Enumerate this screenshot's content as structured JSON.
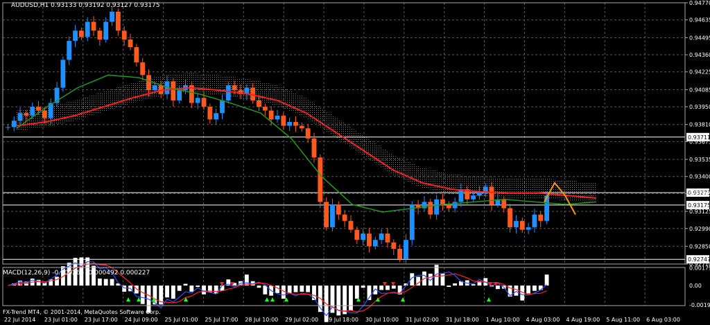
{
  "header": {
    "symbol_line": "AUDUSD,H1  0.93133 0.93192 0.93127 0.93175"
  },
  "macd_header": "MACD(12,26,9) -0.000265 -0.000492 0.000227",
  "copyright": "FX-Trend MT4, © 2001-2014, MetaQuotes Software Corp.",
  "colors": {
    "background": "#000000",
    "grid": "#5a5a5a",
    "candle_up": "#1e90ff",
    "candle_down": "#ff5a1e",
    "ma_red": "#ff2020",
    "ma_green": "#1f9a1f",
    "cloud": "#f5d6c0",
    "forecast": "#ff9900",
    "hline": "#ffffff",
    "macd_hist": "#ffffff",
    "macd_main": "#3050ff",
    "macd_signal": "#ff2020",
    "arrow_up": "#20ff20",
    "arrow_down": "#ff2020"
  },
  "chart_data": {
    "type": "candlestick",
    "price_axis_ticks": [
      "0.94770",
      "0.94635",
      "0.94495",
      "0.94360",
      "0.94225",
      "0.94085",
      "0.93950",
      "0.93810",
      "0.93675",
      "0.93535",
      "0.93400",
      "0.93265",
      "0.93125",
      "0.92990",
      "0.92850",
      "0.92710"
    ],
    "price_markers": [
      "0.93711",
      "0.93273",
      "0.93175",
      "0.92747"
    ],
    "ylim": [
      0.9271,
      0.9477
    ],
    "x_tick_labels": [
      "22 Jul 2014",
      "23 Jul 01:00",
      "23 Jul 17:00",
      "24 Jul 09:00",
      "25 Jul 01:00",
      "25 Jul 17:00",
      "28 Jul 10:00",
      "29 Jul 02:00",
      "29 Jul 18:00",
      "30 Jul 10:00",
      "31 Jul 02:00",
      "31 Jul 18:00",
      "1 Aug 10:00",
      "4 Aug 03:00",
      "4 Aug 19:00",
      "5 Aug 11:00",
      "6 Aug 03:00"
    ],
    "close_path": [
      0.9379,
      0.9384,
      0.939,
      0.9388,
      0.9395,
      0.9392,
      0.9386,
      0.9398,
      0.941,
      0.9432,
      0.9447,
      0.9455,
      0.945,
      0.9462,
      0.9455,
      0.9448,
      0.9462,
      0.947,
      0.9455,
      0.9448,
      0.9442,
      0.943,
      0.942,
      0.9408,
      0.9412,
      0.9405,
      0.9415,
      0.94,
      0.9408,
      0.9412,
      0.9398,
      0.9402,
      0.9395,
      0.9385,
      0.939,
      0.94,
      0.9412,
      0.9408,
      0.9405,
      0.941,
      0.94,
      0.9395,
      0.9392,
      0.9385,
      0.9388,
      0.938,
      0.9383,
      0.938,
      0.9378,
      0.937,
      0.9355,
      0.932,
      0.93,
      0.9318,
      0.931,
      0.9305,
      0.9298,
      0.929,
      0.9295,
      0.9285,
      0.929,
      0.9295,
      0.9288,
      0.9283,
      0.9275,
      0.929,
      0.9318,
      0.9315,
      0.932,
      0.931,
      0.9322,
      0.9318,
      0.9315,
      0.932,
      0.933,
      0.9322,
      0.9325,
      0.9328,
      0.9332,
      0.9318,
      0.9322,
      0.9315,
      0.93,
      0.9305,
      0.9298,
      0.93,
      0.931,
      0.9305,
      0.9325
    ],
    "ma_red": [
      0.938,
      0.9383,
      0.9388,
      0.9395,
      0.9402,
      0.9408,
      0.941,
      0.9408,
      0.9405,
      0.94,
      0.939,
      0.9375,
      0.936,
      0.9345,
      0.9335,
      0.933,
      0.9328,
      0.9327,
      0.9327,
      0.9325,
      0.9323
    ],
    "ma_green": [
      0.9378,
      0.9395,
      0.941,
      0.942,
      0.9418,
      0.941,
      0.9405,
      0.9398,
      0.939,
      0.937,
      0.934,
      0.9318,
      0.9312,
      0.9315,
      0.9318,
      0.932,
      0.9322,
      0.932,
      0.9318,
      0.932
    ],
    "forecast": [
      0.932,
      0.9335,
      0.9325,
      0.931
    ],
    "macd": {
      "ticks": [
        "0.001797",
        "0.00",
        "-0.001962"
      ],
      "ylim": [
        -0.00205,
        0.00185
      ]
    }
  }
}
